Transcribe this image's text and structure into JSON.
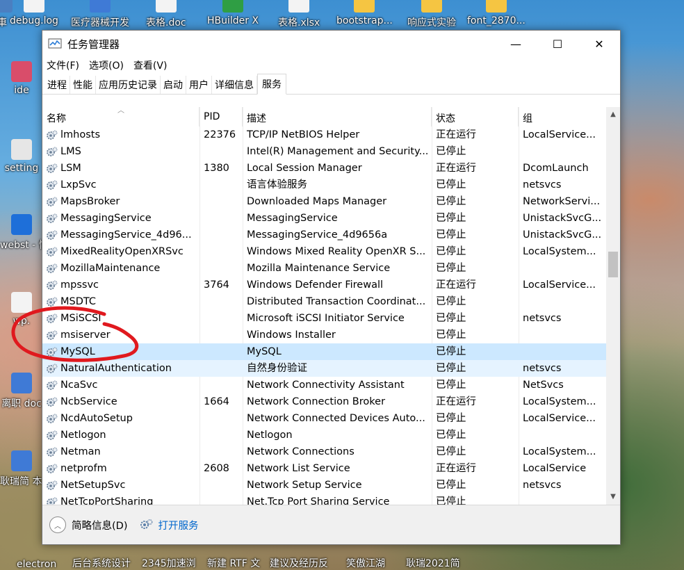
{
  "desktop": {
    "top_icons": [
      {
        "label": "車",
        "color": "#4a7fc1"
      },
      {
        "label": "debug.log",
        "color": "#f3f3f3"
      },
      {
        "label": "医疗器械开发",
        "color": "#3f7ad6"
      },
      {
        "label": "表格.doc",
        "color": "#f3f3f3"
      },
      {
        "label": "HBuilder X",
        "color": "#2f9e44"
      },
      {
        "label": "表格.xlsx",
        "color": "#f3f3f3"
      },
      {
        "label": "bootstrap...",
        "color": "#f5c542"
      },
      {
        "label": "响应式实验",
        "color": "#f5c542"
      },
      {
        "label": "font_2870...",
        "color": "#f5c542"
      }
    ],
    "left_icons": [
      {
        "label": "ide",
        "color": "#d94d6a"
      },
      {
        "label": "setting",
        "color": "#e6e6e6"
      },
      {
        "label": "webst - 快捷",
        "color": "#1e6fd9"
      },
      {
        "label": "wp.",
        "color": "#f3f3f3"
      },
      {
        "label": "离职 doc",
        "color": "#3f7ad6"
      },
      {
        "label": "耿瑞简 本.d",
        "color": "#3f7ad6"
      }
    ],
    "bottom_labels": [
      "electron",
      "后台系统设计",
      "2345加速浏",
      "新建 RTF 文",
      "建议及经历反",
      "笑傲江湖",
      "耿瑞2021简"
    ]
  },
  "window": {
    "title": "任务管理器",
    "controls": {
      "minimize": "—",
      "maximize": "☐",
      "close": "✕"
    },
    "menu": [
      "文件(F)",
      "选项(O)",
      "查看(V)"
    ],
    "tabs": [
      "进程",
      "性能",
      "应用历史记录",
      "启动",
      "用户",
      "详细信息",
      "服务"
    ],
    "active_tab_index": 6,
    "columns": {
      "name": "名称",
      "pid": "PID",
      "desc": "描述",
      "status": "状态",
      "group": "组"
    },
    "rows": [
      {
        "name": "lmhosts",
        "pid": "22376",
        "desc": "TCP/IP NetBIOS Helper",
        "status": "正在运行",
        "group": "LocalService..."
      },
      {
        "name": "LMS",
        "pid": "",
        "desc": "Intel(R) Management and Security...",
        "status": "已停止",
        "group": ""
      },
      {
        "name": "LSM",
        "pid": "1380",
        "desc": "Local Session Manager",
        "status": "正在运行",
        "group": "DcomLaunch"
      },
      {
        "name": "LxpSvc",
        "pid": "",
        "desc": "语言体验服务",
        "status": "已停止",
        "group": "netsvcs"
      },
      {
        "name": "MapsBroker",
        "pid": "",
        "desc": "Downloaded Maps Manager",
        "status": "已停止",
        "group": "NetworkServi..."
      },
      {
        "name": "MessagingService",
        "pid": "",
        "desc": "MessagingService",
        "status": "已停止",
        "group": "UnistackSvcG..."
      },
      {
        "name": "MessagingService_4d96...",
        "pid": "",
        "desc": "MessagingService_4d9656a",
        "status": "已停止",
        "group": "UnistackSvcG..."
      },
      {
        "name": "MixedRealityOpenXRSvc",
        "pid": "",
        "desc": "Windows Mixed Reality OpenXR S...",
        "status": "已停止",
        "group": "LocalSystem..."
      },
      {
        "name": "MozillaMaintenance",
        "pid": "",
        "desc": "Mozilla Maintenance Service",
        "status": "已停止",
        "group": ""
      },
      {
        "name": "mpssvc",
        "pid": "3764",
        "desc": "Windows Defender Firewall",
        "status": "正在运行",
        "group": "LocalService..."
      },
      {
        "name": "MSDTC",
        "pid": "",
        "desc": "Distributed Transaction Coordinat...",
        "status": "已停止",
        "group": ""
      },
      {
        "name": "MSiSCSI",
        "pid": "",
        "desc": "Microsoft iSCSI Initiator Service",
        "status": "已停止",
        "group": "netsvcs"
      },
      {
        "name": "msiserver",
        "pid": "",
        "desc": "Windows Installer",
        "status": "已停止",
        "group": ""
      },
      {
        "name": "MySQL",
        "pid": "",
        "desc": "MySQL",
        "status": "已停止",
        "group": ""
      },
      {
        "name": "NaturalAuthentication",
        "pid": "",
        "desc": "自然身份验证",
        "status": "已停止",
        "group": "netsvcs"
      },
      {
        "name": "NcaSvc",
        "pid": "",
        "desc": "Network Connectivity Assistant",
        "status": "已停止",
        "group": "NetSvcs"
      },
      {
        "name": "NcbService",
        "pid": "1664",
        "desc": "Network Connection Broker",
        "status": "正在运行",
        "group": "LocalSystem..."
      },
      {
        "name": "NcdAutoSetup",
        "pid": "",
        "desc": "Network Connected Devices Auto...",
        "status": "已停止",
        "group": "LocalService..."
      },
      {
        "name": "Netlogon",
        "pid": "",
        "desc": "Netlogon",
        "status": "已停止",
        "group": ""
      },
      {
        "name": "Netman",
        "pid": "",
        "desc": "Network Connections",
        "status": "已停止",
        "group": "LocalSystem..."
      },
      {
        "name": "netprofm",
        "pid": "2608",
        "desc": "Network List Service",
        "status": "正在运行",
        "group": "LocalService"
      },
      {
        "name": "NetSetupSvc",
        "pid": "",
        "desc": "Network Setup Service",
        "status": "已停止",
        "group": "netsvcs"
      },
      {
        "name": "NetTcpPortSharing",
        "pid": "",
        "desc": "Net.Tcp Port Sharing Service",
        "status": "已停止",
        "group": ""
      }
    ],
    "selected_row_index": 13,
    "hover_row_index": 14,
    "scrollbar": {
      "thumb_position": 0.38,
      "thumb_fraction": 0.07
    },
    "footer": {
      "fewer_details": "简略信息(D)",
      "open_services": "打开服务"
    },
    "annotation_color": "#e0191e"
  }
}
